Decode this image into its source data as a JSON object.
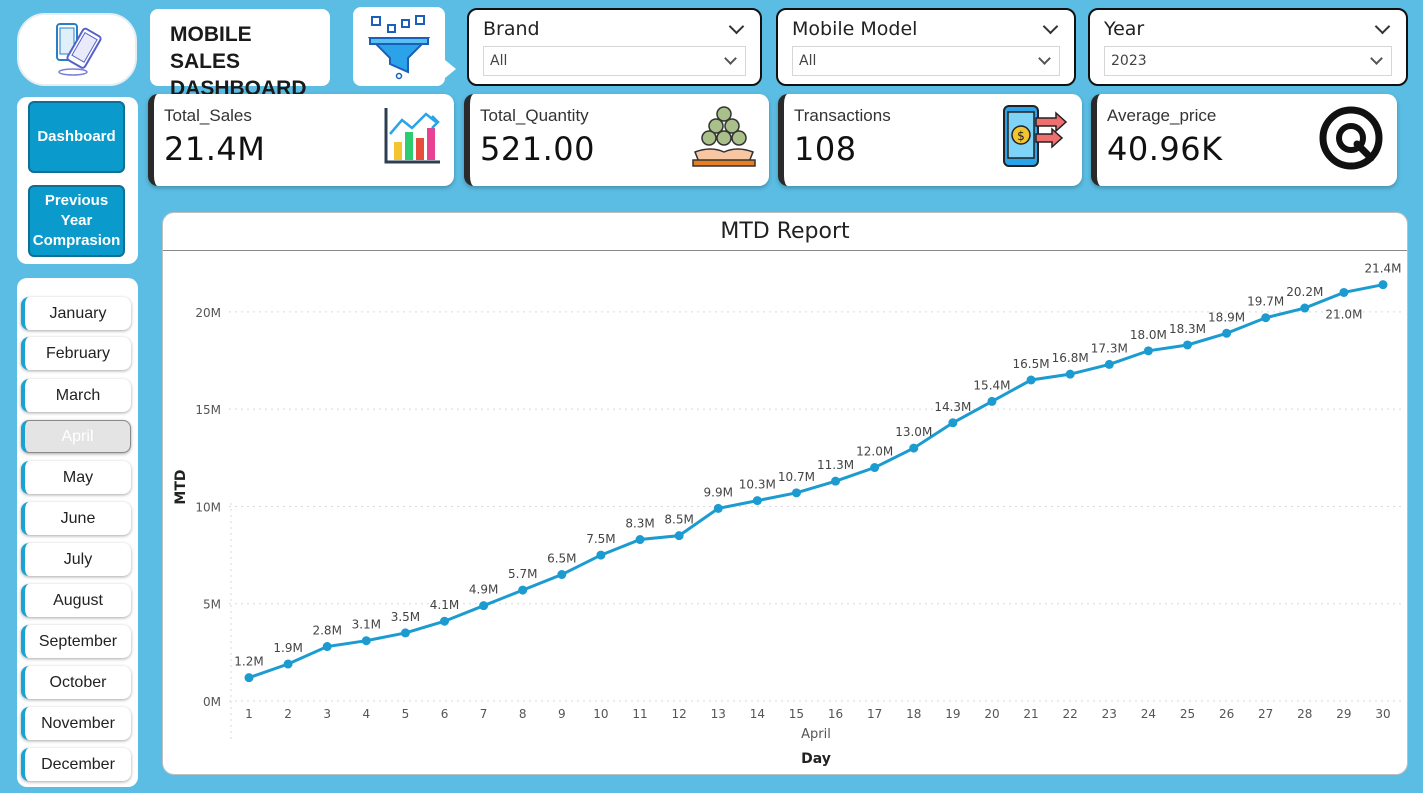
{
  "header": {
    "title_line1": "MOBILE SALES",
    "title_line2": "DASHBOARD"
  },
  "filters": [
    {
      "label": "Brand",
      "value": "All"
    },
    {
      "label": "Mobile Model",
      "value": "All"
    },
    {
      "label": "Year",
      "value": "2023"
    }
  ],
  "kpis": [
    {
      "label": "Total_Sales",
      "value": "21.4M",
      "icon": "bar-chart-icon"
    },
    {
      "label": "Total_Quantity",
      "value": "521.00",
      "icon": "money-stack-icon"
    },
    {
      "label": "Transactions",
      "value": "108",
      "icon": "phone-payment-icon"
    },
    {
      "label": "Average_price",
      "value": "40.96K",
      "icon": "gauge-icon"
    }
  ],
  "nav": {
    "dashboard": "Dashboard",
    "prev_line1": "Previous",
    "prev_line2": "Year",
    "prev_line3": "Comprasion"
  },
  "months": [
    "January",
    "February",
    "March",
    "April",
    "May",
    "June",
    "July",
    "August",
    "September",
    "October",
    "November",
    "December"
  ],
  "selected_month": "April",
  "colors": {
    "accent": "#0a9acb",
    "line": "#1b9bd0",
    "background": "#5bbde3"
  },
  "chart_data": {
    "type": "line",
    "title": "MTD Report",
    "xlabel": "Day",
    "x_group_label": "April",
    "ylabel": "MTD",
    "ylim": [
      0,
      22
    ],
    "yticks": [
      "0M",
      "5M",
      "10M",
      "15M",
      "20M"
    ],
    "grid": true,
    "x": [
      1,
      2,
      3,
      4,
      5,
      6,
      7,
      8,
      9,
      10,
      11,
      12,
      13,
      14,
      15,
      16,
      17,
      18,
      19,
      20,
      21,
      22,
      23,
      24,
      25,
      26,
      27,
      28,
      29,
      30
    ],
    "series": [
      {
        "values": [
          1.2,
          1.9,
          2.8,
          3.1,
          3.5,
          4.1,
          4.9,
          5.7,
          6.5,
          7.5,
          8.3,
          8.5,
          9.9,
          10.3,
          10.7,
          11.3,
          12.0,
          13.0,
          14.3,
          15.4,
          16.5,
          16.8,
          17.3,
          18.0,
          18.3,
          18.9,
          19.7,
          20.2,
          21.0,
          21.4
        ],
        "labels": [
          "1.2M",
          "1.9M",
          "2.8M",
          "3.1M",
          "3.5M",
          "4.1M",
          "4.9M",
          "5.7M",
          "6.5M",
          "7.5M",
          "8.3M",
          "8.5M",
          "9.9M",
          "10.3M",
          "10.7M",
          "11.3M",
          "12.0M",
          "13.0M",
          "14.3M",
          "15.4M",
          "16.5M",
          "16.8M",
          "17.3M",
          "18.0M",
          "18.3M",
          "18.9M",
          "19.7M",
          "20.2M",
          "21.0M",
          "21.4M"
        ]
      }
    ]
  }
}
